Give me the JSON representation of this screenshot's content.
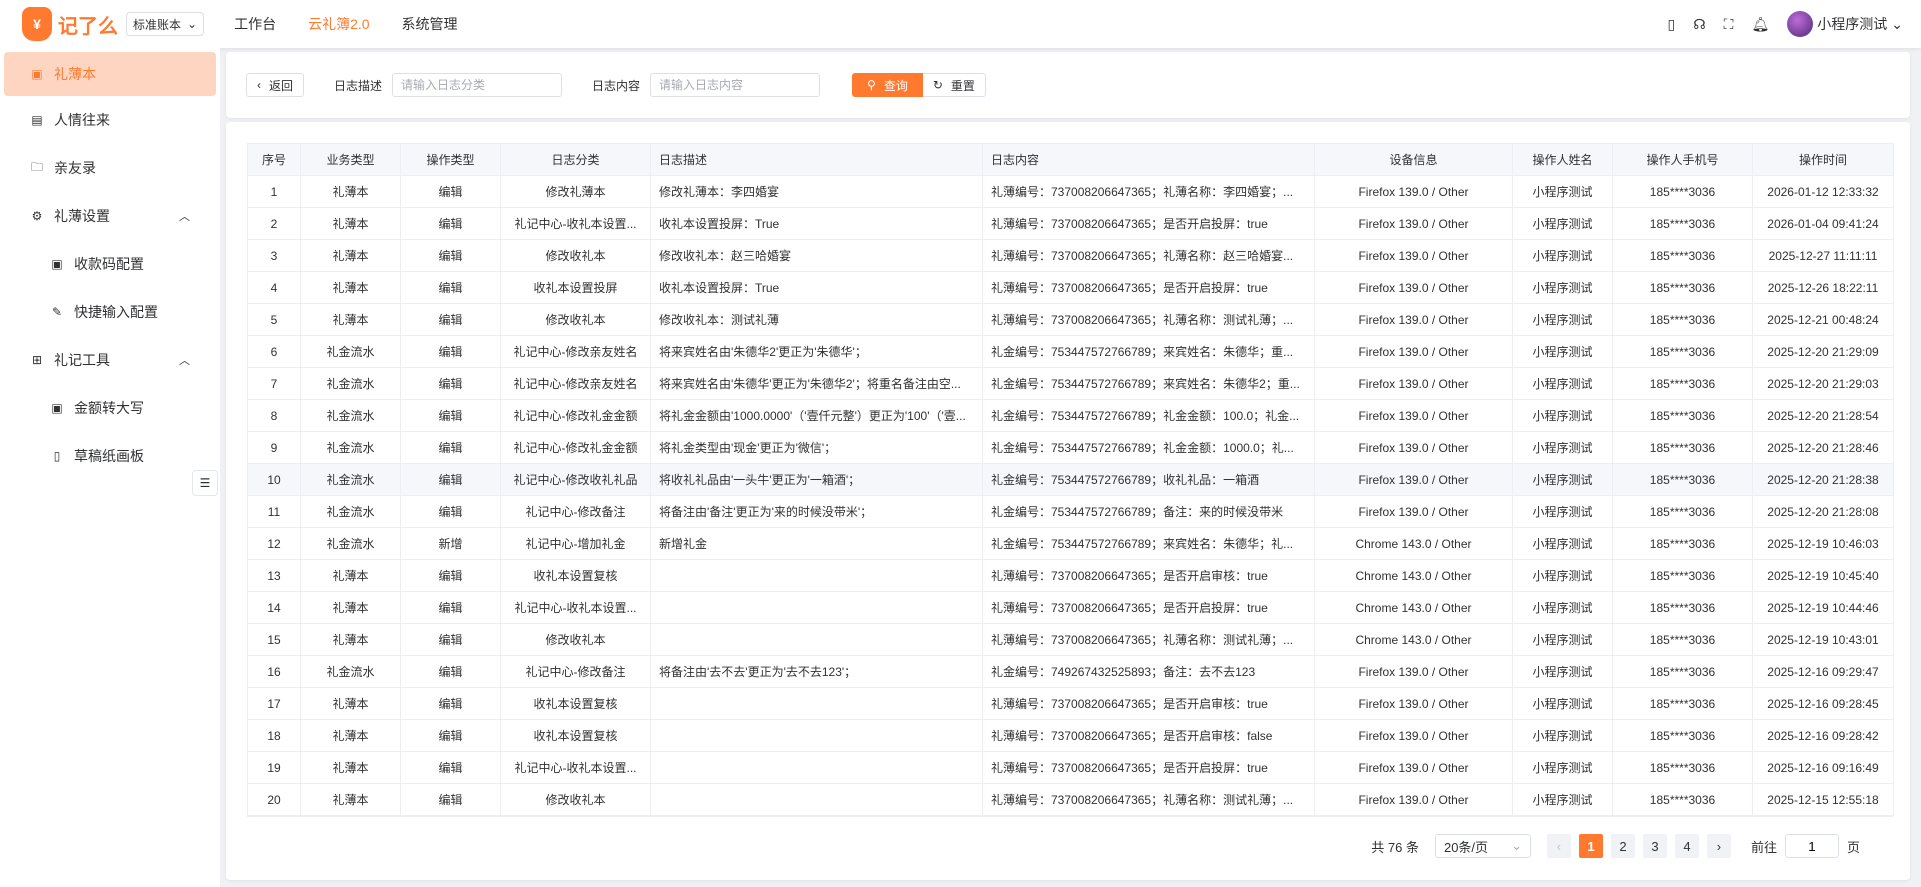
{
  "header": {
    "logo_text": "记了么",
    "logo_glyph": "¥",
    "account_select": "标准账本",
    "nav": [
      "工作台",
      "云礼簿2.0",
      "系统管理"
    ],
    "user_name": "小程序测试"
  },
  "sidebar": {
    "items": [
      {
        "label": "礼薄本",
        "icon": "book-icon",
        "active": true
      },
      {
        "label": "人情往来",
        "icon": "ledger-icon"
      },
      {
        "label": "亲友录",
        "icon": "folder-icon"
      },
      {
        "label": "礼薄设置",
        "icon": "gear-icon",
        "expanded": true
      },
      {
        "label": "收款码配置",
        "icon": "qr-icon",
        "sub": true
      },
      {
        "label": "快捷输入配置",
        "icon": "edit-icon",
        "sub": true
      },
      {
        "label": "礼记工具",
        "icon": "gift-icon",
        "expanded": true
      },
      {
        "label": "金额转大写",
        "icon": "money-icon",
        "sub": true
      },
      {
        "label": "草稿纸画板",
        "icon": "document-icon",
        "sub": true
      }
    ]
  },
  "search": {
    "back": "返回",
    "desc_label": "日志描述",
    "desc_placeholder": "请输入日志分类",
    "content_label": "日志内容",
    "content_placeholder": "请输入日志内容",
    "query": "查询",
    "reset": "重置"
  },
  "table": {
    "columns": [
      "序号",
      "业务类型",
      "操作类型",
      "日志分类",
      "日志描述",
      "日志内容",
      "设备信息",
      "操作人姓名",
      "操作人手机号",
      "操作时间"
    ],
    "rows": [
      [
        "1",
        "礼薄本",
        "编辑",
        "修改礼薄本",
        "修改礼薄本：李四婚宴",
        "礼薄编号：737008206647365；礼薄名称：李四婚宴；...",
        "Firefox 139.0 / Other",
        "小程序测试",
        "185****3036",
        "2026-01-12 12:33:32"
      ],
      [
        "2",
        "礼薄本",
        "编辑",
        "礼记中心-收礼本设置...",
        "收礼本设置投屏：True",
        "礼薄编号：737008206647365；是否开启投屏：true",
        "Firefox 139.0 / Other",
        "小程序测试",
        "185****3036",
        "2026-01-04 09:41:24"
      ],
      [
        "3",
        "礼薄本",
        "编辑",
        "修改收礼本",
        "修改收礼本：赵三哈婚宴",
        "礼薄编号：737008206647365；礼薄名称：赵三哈婚宴...",
        "Firefox 139.0 / Other",
        "小程序测试",
        "185****3036",
        "2025-12-27 11:11:11"
      ],
      [
        "4",
        "礼薄本",
        "编辑",
        "收礼本设置投屏",
        "收礼本设置投屏：True",
        "礼薄编号：737008206647365；是否开启投屏：true",
        "Firefox 139.0 / Other",
        "小程序测试",
        "185****3036",
        "2025-12-26 18:22:11"
      ],
      [
        "5",
        "礼薄本",
        "编辑",
        "修改收礼本",
        "修改收礼本：测试礼薄",
        "礼薄编号：737008206647365；礼薄名称：测试礼薄；...",
        "Firefox 139.0 / Other",
        "小程序测试",
        "185****3036",
        "2025-12-21 00:48:24"
      ],
      [
        "6",
        "礼金流水",
        "编辑",
        "礼记中心-修改亲友姓名",
        "将来宾姓名由'朱德华2'更正为'朱德华'；",
        "礼金编号：753447572766789；来宾姓名：朱德华；重...",
        "Firefox 139.0 / Other",
        "小程序测试",
        "185****3036",
        "2025-12-20 21:29:09"
      ],
      [
        "7",
        "礼金流水",
        "编辑",
        "礼记中心-修改亲友姓名",
        "将来宾姓名由'朱德华'更正为'朱德华2'；将重名备注由空...",
        "礼金编号：753447572766789；来宾姓名：朱德华2；重...",
        "Firefox 139.0 / Other",
        "小程序测试",
        "185****3036",
        "2025-12-20 21:29:03"
      ],
      [
        "8",
        "礼金流水",
        "编辑",
        "礼记中心-修改礼金金额",
        "将礼金金额由'1000.0000'（'壹仟元整'）更正为'100'（'壹...",
        "礼金编号：753447572766789；礼金金额：100.0；礼金...",
        "Firefox 139.0 / Other",
        "小程序测试",
        "185****3036",
        "2025-12-20 21:28:54"
      ],
      [
        "9",
        "礼金流水",
        "编辑",
        "礼记中心-修改礼金金额",
        "将礼金类型由'现金'更正为'微信'；",
        "礼金编号：753447572766789；礼金金额：1000.0；礼...",
        "Firefox 139.0 / Other",
        "小程序测试",
        "185****3036",
        "2025-12-20 21:28:46"
      ],
      [
        "10",
        "礼金流水",
        "编辑",
        "礼记中心-修改收礼礼品",
        "将收礼礼品由'一头牛'更正为'一箱酒'；",
        "礼金编号：753447572766789；收礼礼品：一箱酒",
        "Firefox 139.0 / Other",
        "小程序测试",
        "185****3036",
        "2025-12-20 21:28:38"
      ],
      [
        "11",
        "礼金流水",
        "编辑",
        "礼记中心-修改备注",
        "将备注由'备注'更正为'来的时候没带米'；",
        "礼金编号：753447572766789；备注：来的时候没带米",
        "Firefox 139.0 / Other",
        "小程序测试",
        "185****3036",
        "2025-12-20 21:28:08"
      ],
      [
        "12",
        "礼金流水",
        "新增",
        "礼记中心-增加礼金",
        "新增礼金",
        "礼金编号：753447572766789；来宾姓名：朱德华；礼...",
        "Chrome 143.0 / Other",
        "小程序测试",
        "185****3036",
        "2025-12-19 10:46:03"
      ],
      [
        "13",
        "礼薄本",
        "编辑",
        "收礼本设置复核",
        "",
        "礼薄编号：737008206647365；是否开启审核：true",
        "Chrome 143.0 / Other",
        "小程序测试",
        "185****3036",
        "2025-12-19 10:45:40"
      ],
      [
        "14",
        "礼薄本",
        "编辑",
        "礼记中心-收礼本设置...",
        "",
        "礼薄编号：737008206647365；是否开启投屏：true",
        "Chrome 143.0 / Other",
        "小程序测试",
        "185****3036",
        "2025-12-19 10:44:46"
      ],
      [
        "15",
        "礼薄本",
        "编辑",
        "修改收礼本",
        "",
        "礼薄编号：737008206647365；礼薄名称：测试礼薄；...",
        "Chrome 143.0 / Other",
        "小程序测试",
        "185****3036",
        "2025-12-19 10:43:01"
      ],
      [
        "16",
        "礼金流水",
        "编辑",
        "礼记中心-修改备注",
        "将备注由'去不去'更正为'去不去123'；",
        "礼金编号：749267432525893；备注：去不去123",
        "Firefox 139.0 / Other",
        "小程序测试",
        "185****3036",
        "2025-12-16 09:29:47"
      ],
      [
        "17",
        "礼薄本",
        "编辑",
        "收礼本设置复核",
        "",
        "礼薄编号：737008206647365；是否开启审核：true",
        "Firefox 139.0 / Other",
        "小程序测试",
        "185****3036",
        "2025-12-16 09:28:45"
      ],
      [
        "18",
        "礼薄本",
        "编辑",
        "收礼本设置复核",
        "",
        "礼薄编号：737008206647365；是否开启审核：false",
        "Firefox 139.0 / Other",
        "小程序测试",
        "185****3036",
        "2025-12-16 09:28:42"
      ],
      [
        "19",
        "礼薄本",
        "编辑",
        "礼记中心-收礼本设置...",
        "",
        "礼薄编号：737008206647365；是否开启投屏：true",
        "Firefox 139.0 / Other",
        "小程序测试",
        "185****3036",
        "2025-12-16 09:16:49"
      ],
      [
        "20",
        "礼薄本",
        "编辑",
        "修改收礼本",
        "",
        "礼薄编号：737008206647365；礼薄名称：测试礼薄；...",
        "Firefox 139.0 / Other",
        "小程序测试",
        "185****3036",
        "2025-12-15 12:55:18"
      ]
    ],
    "highlight_row": 10
  },
  "pagination": {
    "total": "共 76 条",
    "page_size": "20条/页",
    "pages": [
      "1",
      "2",
      "3",
      "4"
    ],
    "current": "1",
    "goto_label": "前往",
    "goto_value": "1",
    "page_suffix": "页",
    "prev": "‹",
    "next": "›"
  },
  "colors": {
    "accent": "#ff7a2e",
    "active_bg": "#fdd5c0"
  }
}
